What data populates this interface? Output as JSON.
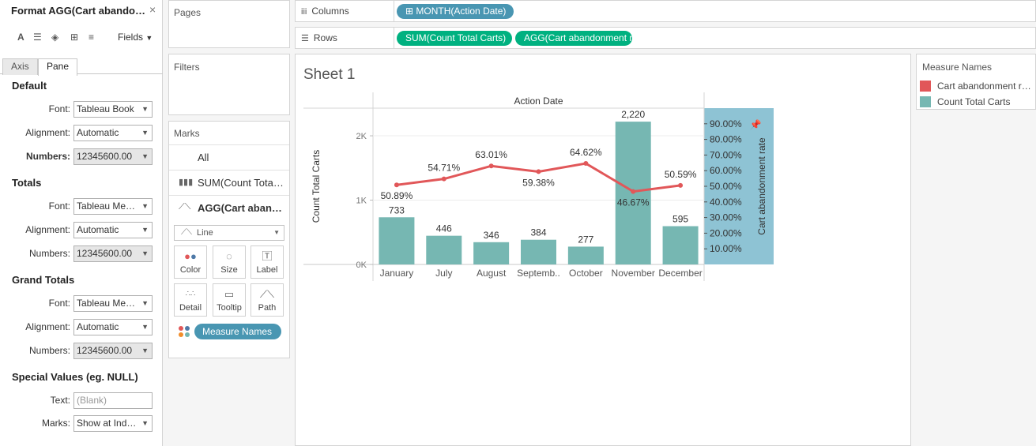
{
  "format_pane": {
    "title": "Format AGG(Cart abandonment rate)",
    "close_glyph": "×",
    "fields_label": "Fields",
    "tabs": [
      {
        "label": "Axis",
        "active": false
      },
      {
        "label": "Pane",
        "active": true
      }
    ],
    "sections": {
      "default": {
        "title": "Default",
        "font_label": "Font:",
        "font_value": "Tableau Book",
        "alignment_label": "Alignment:",
        "alignment_value": "Automatic",
        "numbers_label": "Numbers:",
        "numbers_value": "12345600.00"
      },
      "totals": {
        "title": "Totals",
        "font_label": "Font:",
        "font_value": "Tableau Medium",
        "alignment_label": "Alignment:",
        "alignment_value": "Automatic",
        "numbers_label": "Numbers:",
        "numbers_value": "12345600.00"
      },
      "grand_totals": {
        "title": "Grand Totals",
        "font_label": "Font:",
        "font_value": "Tableau Medium",
        "alignment_label": "Alignment:",
        "alignment_value": "Automatic",
        "numbers_label": "Numbers:",
        "numbers_value": "12345600.00"
      },
      "special_values": {
        "title": "Special Values (eg. NULL)",
        "text_label": "Text:",
        "text_placeholder": "(Blank)",
        "marks_label": "Marks:",
        "marks_value": "Show at Indicator"
      }
    }
  },
  "pages": {
    "title": "Pages"
  },
  "filters": {
    "title": "Filters"
  },
  "marks": {
    "title": "Marks",
    "rows": [
      {
        "label": "All"
      },
      {
        "label": "SUM(Count Total Carts)"
      },
      {
        "label": "AGG(Cart abandonment rate)"
      }
    ],
    "mark_type": "Line",
    "buttons": {
      "color": "Color",
      "size": "Size",
      "label": "Label",
      "detail": "Detail",
      "tooltip": "Tooltip",
      "path": "Path"
    },
    "measure_pill": "Measure Names"
  },
  "shelves": {
    "columns_label": "Columns",
    "rows_label": "Rows",
    "columns_pill": "MONTH(Action Date)",
    "rows_pills": [
      "SUM(Count Total Carts)",
      "AGG(Cart abandonment rate)"
    ]
  },
  "sheet": {
    "title": "Sheet 1"
  },
  "legend": {
    "title": "Measure Names",
    "items": [
      {
        "label": "Cart abandonment rate",
        "color": "#e15759"
      },
      {
        "label": "Count Total Carts",
        "color": "#76b7b2"
      }
    ]
  },
  "colors": {
    "bar": "#76b7b2",
    "line": "#e15759",
    "highlight_axis": "#8ec3d4",
    "pill_blue": "#4996b2",
    "pill_green": "#00b180"
  },
  "chart_data": {
    "type": "bar",
    "header": "Action Date",
    "categories": [
      "January",
      "July",
      "August",
      "Septemb..",
      "October",
      "November",
      "December"
    ],
    "series": [
      {
        "name": "Count Total Carts",
        "type": "bar",
        "axis": "left",
        "values": [
          733,
          446,
          346,
          384,
          277,
          2220,
          595
        ],
        "labels": [
          "733",
          "446",
          "346",
          "384",
          "277",
          "2,220",
          "595"
        ]
      },
      {
        "name": "Cart abandonment rate",
        "type": "line",
        "axis": "right",
        "values": [
          50.89,
          54.71,
          63.01,
          59.38,
          64.62,
          46.67,
          50.59
        ],
        "labels": [
          "50.89%",
          "54.71%",
          "63.01%",
          "59.38%",
          "64.62%",
          "46.67%",
          "50.59%"
        ]
      }
    ],
    "left_axis": {
      "label": "Count Total Carts",
      "ticks": [
        {
          "value": 0,
          "label": "0K"
        },
        {
          "value": 1000,
          "label": "1K"
        },
        {
          "value": 2000,
          "label": "2K"
        }
      ],
      "range": [
        0,
        2430
      ]
    },
    "right_axis": {
      "label": "Cart abandonment rate",
      "ticks": [
        {
          "value": 10,
          "label": "10.00%"
        },
        {
          "value": 20,
          "label": "20.00%"
        },
        {
          "value": 30,
          "label": "30.00%"
        },
        {
          "value": 40,
          "label": "40.00%"
        },
        {
          "value": 50,
          "label": "50.00%"
        },
        {
          "value": 60,
          "label": "60.00%"
        },
        {
          "value": 70,
          "label": "70.00%"
        },
        {
          "value": 80,
          "label": "80.00%"
        },
        {
          "value": 90,
          "label": "90.00%"
        }
      ],
      "range": [
        0,
        100
      ]
    },
    "grid": true,
    "legend_position": "right"
  }
}
